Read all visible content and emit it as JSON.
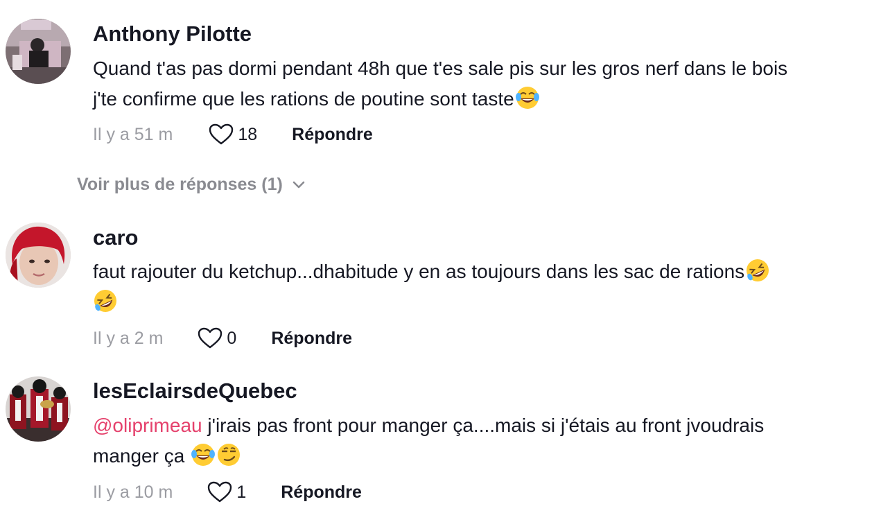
{
  "comments": [
    {
      "username": "Anthony Pilotte",
      "line1": "Quand t'as pas dormi pendant 48h que t'es sale pis sur les gros nerf dans le bois",
      "line2": "j'te confirme que les rations de poutine sont taste",
      "emoji": [
        "joy-emoji"
      ],
      "time": "Il y a 51 m",
      "likes": "18",
      "reply": "Répondre"
    },
    {
      "username": "caro",
      "line1": "faut rajouter du ketchup...dhabitude y en as toujours dans les sac de rations",
      "emoji": [
        "rofl-emoji",
        "rofl-emoji"
      ],
      "time": "Il y a 2 m",
      "likes": "0",
      "reply": "Répondre"
    },
    {
      "username": "lesEclairsdeQuebec",
      "mention": "@oliprimeau",
      "line1": " j'irais pas front pour manger ça....mais si j'étais au front jvoudrais",
      "line2": "manger ça ",
      "emoji": [
        "joy-emoji",
        "smirk-emoji"
      ],
      "time": "Il y a 10 m",
      "likes": "1",
      "reply": "Répondre"
    }
  ],
  "view_more": "Voir plus de réponses (1)",
  "icons": {
    "like": "heart-outline-icon",
    "expand": "chevron-down-icon"
  },
  "colors": {
    "mention": "#e5416c",
    "meta": "#9b9ca2",
    "text": "#161823"
  }
}
